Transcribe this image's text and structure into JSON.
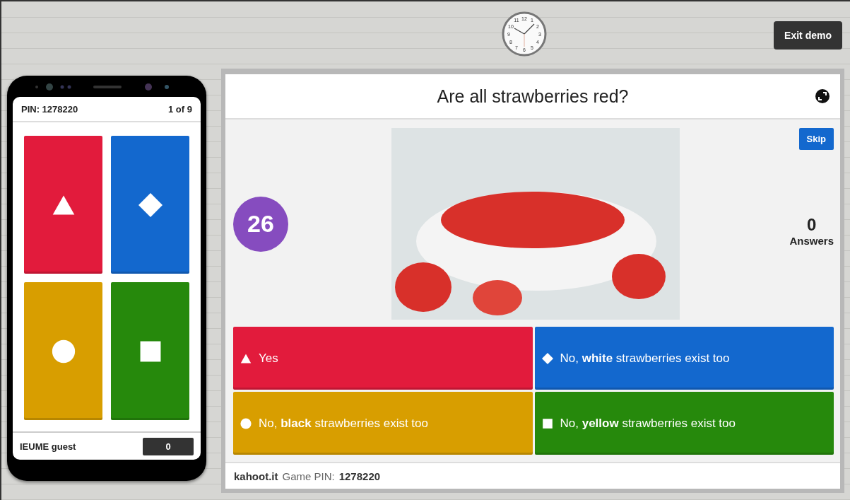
{
  "clock": {
    "numerals": [
      "11",
      "12",
      "1",
      "10",
      "2",
      "9",
      "3",
      "8",
      "4",
      "7",
      "5",
      "6"
    ]
  },
  "exit_button": {
    "label": "Exit demo"
  },
  "phone": {
    "pin": "PIN: 1278220",
    "counter": "1 of 9",
    "tiles": [
      {
        "kind": "triangle",
        "color": "#e21b3c"
      },
      {
        "kind": "diamond",
        "color": "#1368ce"
      },
      {
        "kind": "circle",
        "color": "#d89e00"
      },
      {
        "kind": "square",
        "color": "#26890c"
      }
    ],
    "player": "IEUME guest",
    "score": "0"
  },
  "question": {
    "title": "Are all strawberries red?",
    "timer": "26",
    "skip": "Skip",
    "answer_count": "0",
    "answer_label": "Answers",
    "answers": [
      {
        "kind": "triangle",
        "color": "#e21b3c",
        "text": "Yes"
      },
      {
        "kind": "diamond",
        "color": "#1368ce",
        "text": "No, **white** strawberries exist too"
      },
      {
        "kind": "circle",
        "color": "#d89e00",
        "text": "No, **black** strawberries exist too"
      },
      {
        "kind": "square",
        "color": "#26890c",
        "text": "No, **yellow** strawberries exist too"
      }
    ]
  },
  "footer": {
    "site": "kahoot.it",
    "pin_label": "Game PIN:",
    "pin": "1278220"
  }
}
